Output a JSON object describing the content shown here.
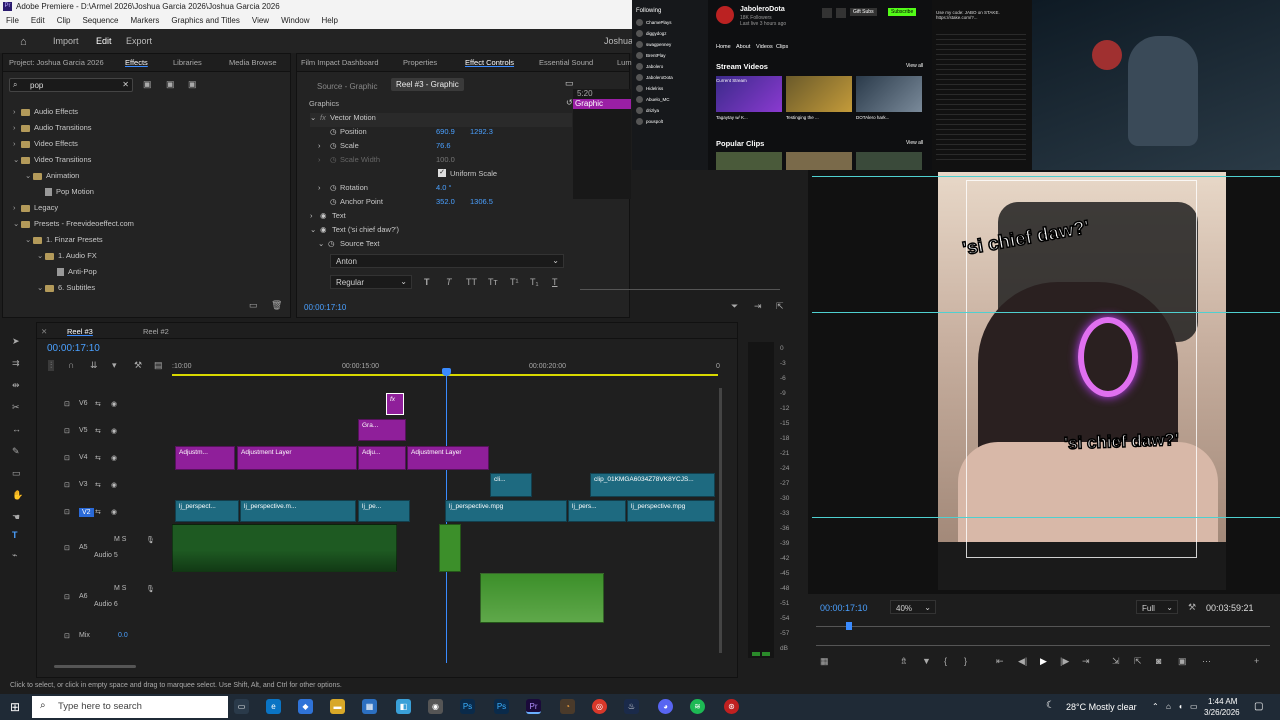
{
  "window": {
    "title": "Adobe Premiere - D:\\Armel 2026\\Joshua Garcia 2026\\Joshua Garcia 2026"
  },
  "menu": [
    "File",
    "Edit",
    "Clip",
    "Sequence",
    "Markers",
    "Graphics and Titles",
    "View",
    "Window",
    "Help"
  ],
  "workspace": {
    "import": "Import",
    "edit": "Edit",
    "export": "Export",
    "user": "Joshua"
  },
  "project_panel": {
    "tabs": [
      "Project: Joshua Garcia 2026",
      "Effects",
      "Libraries",
      "Media Browse"
    ],
    "search_value": "pop",
    "tree": [
      {
        "label": "Audio Effects",
        "depth": 0,
        "type": "folder",
        "caret": "›"
      },
      {
        "label": "Audio Transitions",
        "depth": 0,
        "type": "folder",
        "caret": "›"
      },
      {
        "label": "Video Effects",
        "depth": 0,
        "type": "folder",
        "caret": "›"
      },
      {
        "label": "Video Transitions",
        "depth": 0,
        "type": "folder",
        "caret": "⌄"
      },
      {
        "label": "Animation",
        "depth": 1,
        "type": "folder",
        "caret": "⌄"
      },
      {
        "label": "Pop Motion",
        "depth": 2,
        "type": "file",
        "caret": ""
      },
      {
        "label": "Legacy",
        "depth": 0,
        "type": "folder",
        "caret": "›"
      },
      {
        "label": "Presets - Freevideoeffect.com",
        "depth": 0,
        "type": "folder",
        "caret": "⌄"
      },
      {
        "label": "1. Finzar Presets",
        "depth": 1,
        "type": "folder",
        "caret": "⌄"
      },
      {
        "label": "1. Audio FX",
        "depth": 2,
        "type": "folder",
        "caret": "⌄"
      },
      {
        "label": "Anti-Pop",
        "depth": 3,
        "type": "file",
        "caret": ""
      },
      {
        "label": "6. Subtitles",
        "depth": 2,
        "type": "folder",
        "caret": "⌄"
      }
    ]
  },
  "effect_controls": {
    "tabs": [
      "Film Impact Dashboard",
      "Properties",
      "Effect Controls",
      "Essential Sound",
      "Lum"
    ],
    "source_label": "Source - Graphic",
    "target_label": "Reel #3 - Graphic",
    "section": "Graphics",
    "vector_motion": "Vector Motion",
    "position": {
      "label": "Position",
      "x": "690.9",
      "y": "1292.3"
    },
    "scale": {
      "label": "Scale",
      "value": "76.6"
    },
    "scale_width": {
      "label": "Scale Width",
      "value": "100.0"
    },
    "uniform_scale": "Uniform Scale",
    "rotation": {
      "label": "Rotation",
      "value": "4.0 °"
    },
    "anchor_point": {
      "label": "Anchor Point",
      "x": "352.0",
      "y": "1306.5"
    },
    "text": "Text",
    "text_layer": "Text ('si chief daw?')",
    "source_text": "Source Text",
    "font": "Anton",
    "style": "Regular",
    "timecode": "00:00:17:10",
    "clip_badge": "Graphic",
    "mini_time": "5:20"
  },
  "timeline": {
    "tabs": [
      "Reel #3",
      "Reel #2"
    ],
    "timecode": "00:00:17:10",
    "ruler": [
      ":10:00",
      "00:00:15:00",
      "00:00:20:00",
      "0"
    ],
    "tracks": [
      {
        "name": "V6"
      },
      {
        "name": "V5"
      },
      {
        "name": "V4"
      },
      {
        "name": "V3"
      },
      {
        "name": "V2"
      },
      {
        "name": "A5",
        "sub": "Audio 5"
      },
      {
        "name": "A6",
        "sub": "Audio 6"
      },
      {
        "name": "Mix",
        "value": "0.0"
      }
    ],
    "clips": {
      "v5": "Gra...",
      "v4": [
        "Adjustm...",
        "Adjustment Layer",
        "Adju...",
        "Adjustment Layer"
      ],
      "v3": [
        "cli...",
        "clip_01KMGA6034Z78VK8YCJS..."
      ],
      "v2": [
        "lj_perspect...",
        "lj_perspective.m...",
        "lj_pe...",
        "lj_perspective.mpg",
        "lj_pers...",
        "lj_perspective.mpg"
      ]
    }
  },
  "meter_scale": [
    "0",
    "-3",
    "-6",
    "-9",
    "-12",
    "-15",
    "-18",
    "-21",
    "-24",
    "-27",
    "-30",
    "-33",
    "-36",
    "-39",
    "-42",
    "-45",
    "-48",
    "-51",
    "-54",
    "-57",
    "dB"
  ],
  "program": {
    "timecode": "00:00:17:10",
    "zoom": "40%",
    "quality": "Full",
    "duration": "00:03:59:21",
    "caption_1": "'si chief daw?'",
    "caption_2": "'si chief daw?'"
  },
  "stream_overlay": {
    "channel": "JaboleroDota",
    "followers": "18K Followers",
    "last_live": "Last live 3 hours ago",
    "nav": [
      "Home",
      "About",
      "Videos",
      "Clips"
    ],
    "stream_videos": "Stream Videos",
    "popular_clips": "Popular Clips",
    "view_all": "View all",
    "gift_subs": "Gift Subs",
    "subscribe": "Subscribe",
    "following": "Following",
    "following_list": [
      "ChamePlays",
      "diggydogz",
      "swagpenney",
      "BrentPlay",
      "Jabolero",
      "JaboleroDota",
      "Hidelriss",
      "Abuelo_MC",
      "drizlya",
      "pouspolt"
    ],
    "videos": [
      "Current Stream",
      "Tagaytay w/ K...",
      "Testinging the ...",
      "DOTAlero hark..."
    ],
    "chat_promo": "Use my code: JABO on STAKE. https://stake.com/?..."
  },
  "status_bar": "Click to select, or click in empty space and drag to marquee select. Use Shift, Alt, and Ctrl for other options.",
  "taskbar": {
    "search_placeholder": "Type here to search",
    "weather": "28°C  Mostly clear",
    "time": "1:44 AM",
    "date": "3/26/2026"
  },
  "colors": {
    "accent": "#3a8bff",
    "purple": "#8f1f9a",
    "teal": "#1e6a80",
    "green": "#1e5a22",
    "timecode": "#4aa0ff",
    "playhead": "#3a8bff"
  }
}
